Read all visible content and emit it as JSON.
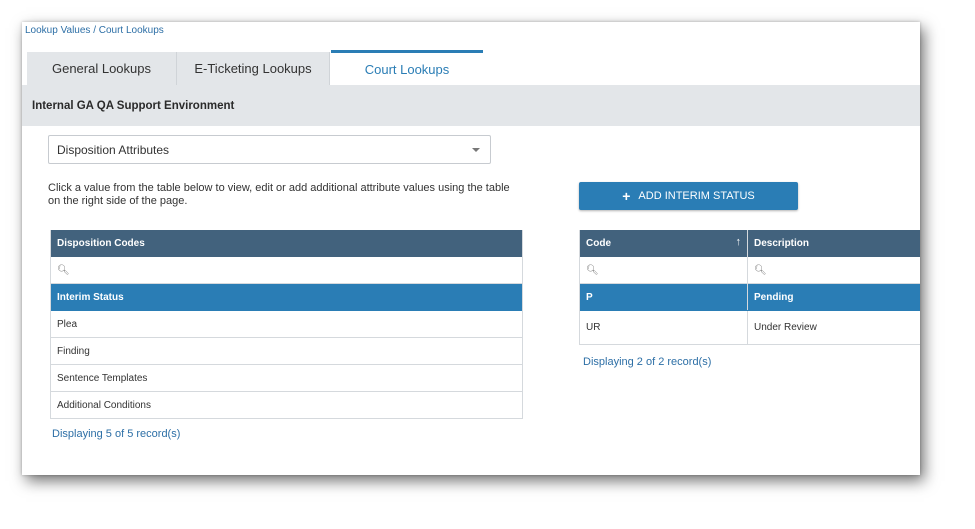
{
  "breadcrumb": "Lookup Values / Court Lookups",
  "tabs": [
    {
      "label": "General Lookups"
    },
    {
      "label": "E-Ticketing Lookups"
    },
    {
      "label": "Court Lookups"
    }
  ],
  "environment": "Internal GA QA Support Environment",
  "attribute_select": {
    "value": "Disposition Attributes"
  },
  "instructions": "Click a value from the table below to view, edit or add additional attribute values using the table on the right side of the page.",
  "add_button": {
    "label": "ADD INTERIM STATUS"
  },
  "left_table": {
    "header": "Disposition Codes",
    "rows": [
      "Interim Status",
      "Plea",
      "Finding",
      "Sentence Templates",
      "Additional Conditions"
    ],
    "count": "Displaying 5 of 5 record(s)"
  },
  "right_table": {
    "headers": {
      "code": "Code",
      "description": "Description"
    },
    "rows": [
      {
        "code": "P",
        "description": "Pending"
      },
      {
        "code": "UR",
        "description": "Under Review"
      }
    ],
    "count": "Displaying 2 of 2 record(s)"
  },
  "colors": {
    "accent": "#2a7db5",
    "header": "#42627d",
    "tab_inactive": "#e3e6e9"
  }
}
